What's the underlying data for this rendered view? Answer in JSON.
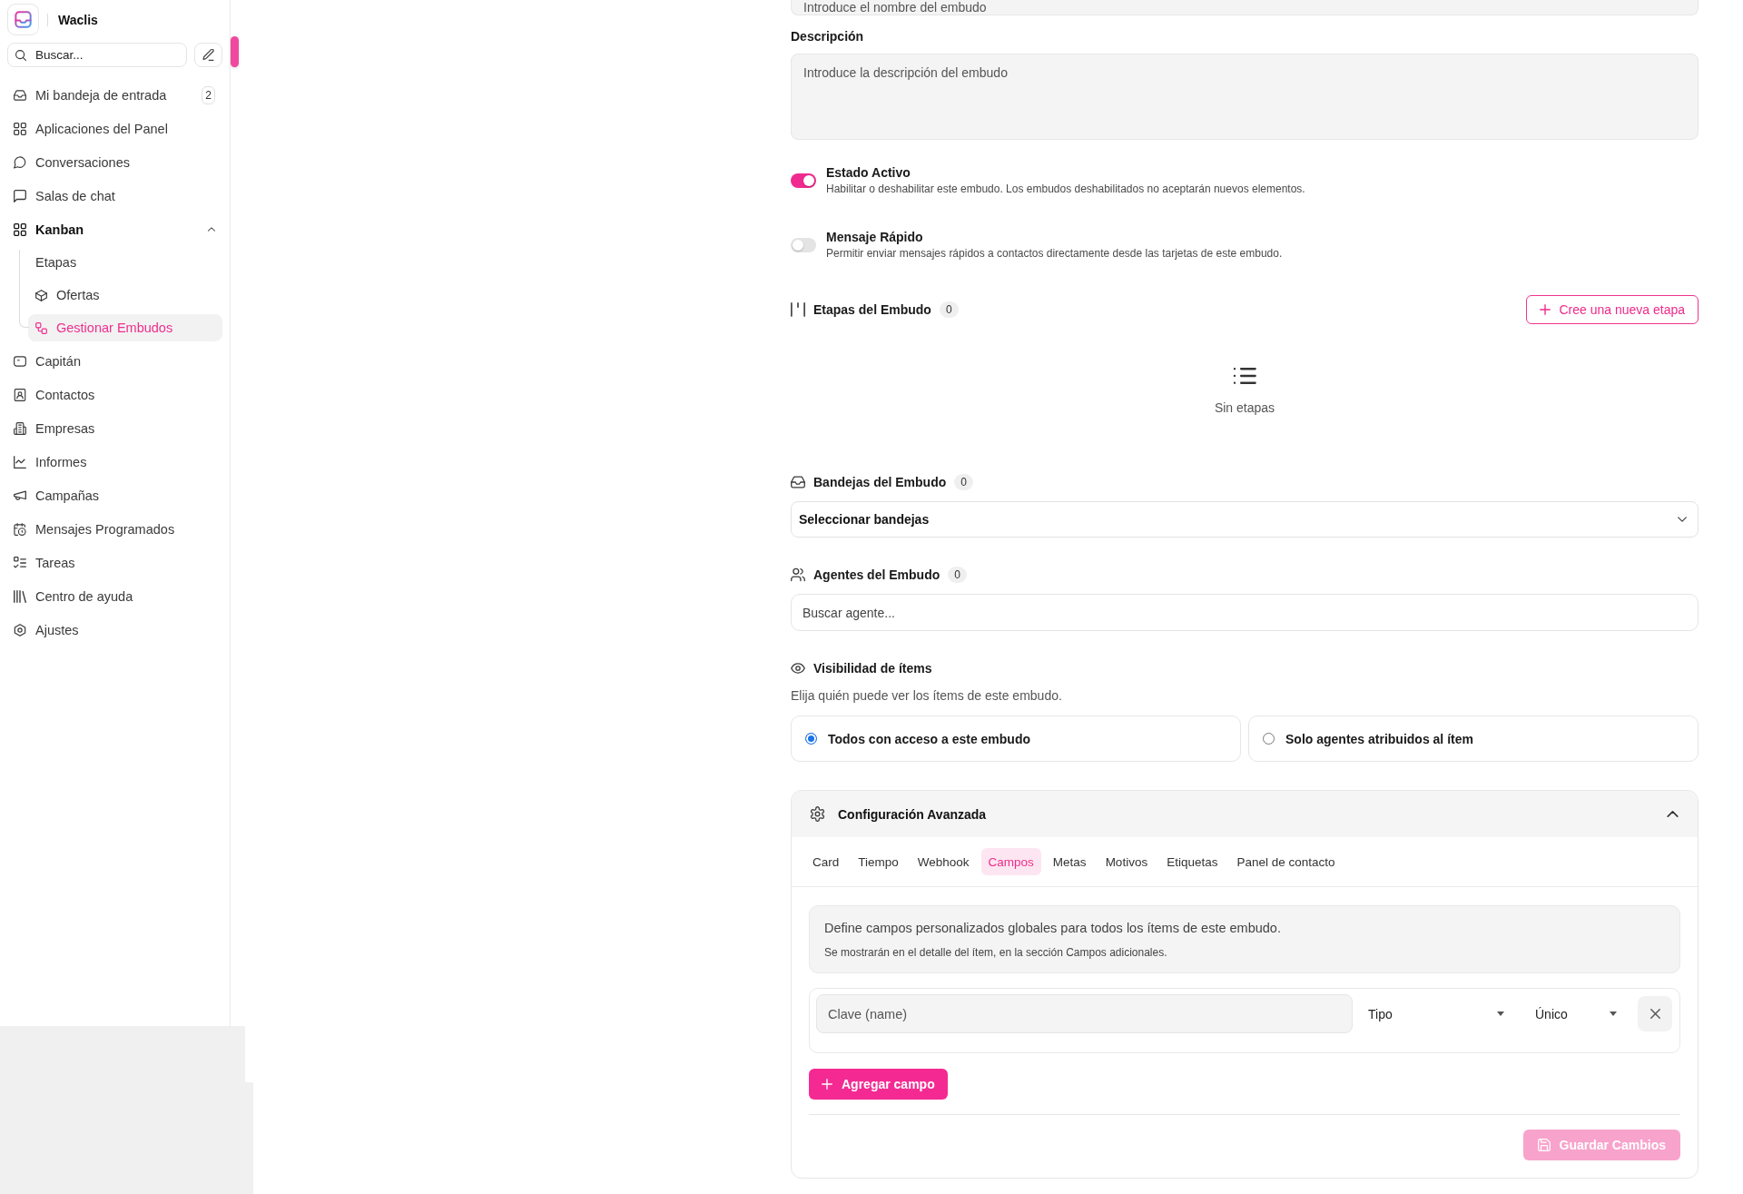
{
  "sidebar": {
    "brand": "Waclis",
    "search": {
      "placeholder": "Buscar..."
    },
    "items": [
      {
        "label": "Mi bandeja de entrada",
        "badge": "2",
        "selected": false
      },
      {
        "label": "Aplicaciones del Panel",
        "selected": false
      },
      {
        "label": "Conversaciones",
        "selected": false
      },
      {
        "label": "Salas de chat",
        "selected": false
      },
      {
        "label": "Kanban",
        "selected": false,
        "expanded": true,
        "children": [
          {
            "label": "Etapas",
            "selected": false
          },
          {
            "label": "Ofertas",
            "selected": false
          },
          {
            "label": "Gestionar Embudos",
            "selected": true
          }
        ]
      },
      {
        "label": "Capitán",
        "selected": false
      },
      {
        "label": "Contactos",
        "selected": false
      },
      {
        "label": "Empresas",
        "selected": false
      },
      {
        "label": "Informes",
        "selected": false
      },
      {
        "label": "Campañas",
        "selected": false
      },
      {
        "label": "Mensajes Programados",
        "selected": false
      },
      {
        "label": "Tareas",
        "selected": false
      },
      {
        "label": "Centro de ayuda",
        "selected": false
      },
      {
        "label": "Ajustes",
        "selected": false
      }
    ]
  },
  "form": {
    "name_field": {
      "placeholder": "Introduce el nombre del embudo"
    },
    "description": {
      "label": "Descripción",
      "placeholder": "Introduce la descripción del embudo"
    },
    "toggles": [
      {
        "title": "Estado Activo",
        "description": "Habilitar o deshabilitar este embudo. Los embudos deshabilitados no aceptarán nuevos elementos.",
        "on": true
      },
      {
        "title": "Mensaje Rápido",
        "description": "Permitir enviar mensajes rápidos a contactos directamente desde las tarjetas de este embudo.",
        "on": false
      }
    ],
    "stages": {
      "title": "Etapas del Embudo",
      "count": "0",
      "add_button": "Cree una nueva etapa",
      "empty_text": "Sin etapas"
    },
    "inboxes": {
      "title": "Bandejas del Embudo",
      "count": "0",
      "select": {
        "value": "Seleccionar bandejas"
      }
    },
    "agents": {
      "title": "Agentes del Embudo",
      "count": "0",
      "search": {
        "placeholder": "Buscar agente..."
      }
    },
    "visibility": {
      "title": "Visibilidad de ítems",
      "hint": "Elija quién puede ver los ítems de este embudo.",
      "options": [
        {
          "label": "Todos con acceso a este embudo",
          "selected": true
        },
        {
          "label": "Solo agentes atribuidos al ítem",
          "selected": false
        }
      ]
    },
    "advanced": {
      "title": "Configuración Avanzada",
      "expanded": true,
      "tabs": [
        {
          "label": "Card",
          "selected": false
        },
        {
          "label": "Tiempo",
          "selected": false
        },
        {
          "label": "Webhook",
          "selected": false
        },
        {
          "label": "Campos",
          "selected": true
        },
        {
          "label": "Metas",
          "selected": false
        },
        {
          "label": "Motivos",
          "selected": false
        },
        {
          "label": "Etiquetas",
          "selected": false
        },
        {
          "label": "Panel de contacto",
          "selected": false
        }
      ],
      "info": {
        "text": "Define campos personalizados globales para todos los ítems de este embudo.",
        "note": "Se mostrarán en el detalle del ítem, en la sección Campos adicionales."
      },
      "fields": [
        {
          "key": {
            "placeholder": "Clave (name)"
          },
          "type": {
            "value": "Tipo"
          },
          "mode": {
            "value": "Único"
          }
        }
      ],
      "add_button": "Agregar campo",
      "save_button": {
        "label": "Guardar Cambios",
        "disabled": true
      }
    }
  }
}
